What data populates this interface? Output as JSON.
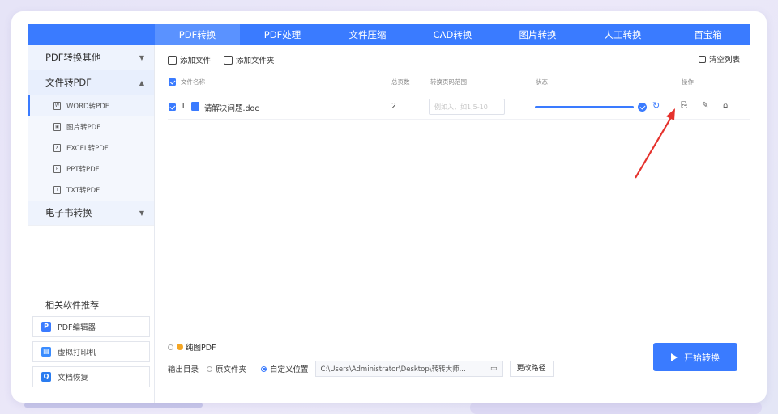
{
  "nav": {
    "tabs": [
      "PDF转换",
      "PDF处理",
      "文件压缩",
      "CAD转换",
      "图片转换",
      "人工转换",
      "百宝箱"
    ],
    "active_index": 0
  },
  "sidebar": {
    "groups": [
      {
        "label": "PDF转换其他",
        "expanded": false
      },
      {
        "label": "文件转PDF",
        "expanded": true
      },
      {
        "label": "电子书转换",
        "expanded": false
      }
    ],
    "sub_items": [
      "WORD转PDF",
      "图片转PDF",
      "EXCEL转PDF",
      "PPT转PDF",
      "TXT转PDF"
    ],
    "active_sub": 0
  },
  "recommend": {
    "title": "相关软件推荐",
    "items": [
      {
        "label": "PDF编辑器",
        "icon": "pdf-editor-icon",
        "color": "#3a7bff"
      },
      {
        "label": "虚拟打印机",
        "icon": "printer-icon",
        "color": "#3a8cff"
      },
      {
        "label": "文档恢复",
        "icon": "recovery-icon",
        "color": "#2a7cf0"
      }
    ]
  },
  "toolbar": {
    "add_file": "添加文件",
    "add_folder": "添加文件夹",
    "clear_list": "清空列表"
  },
  "table": {
    "headers": {
      "name": "文件名称",
      "pages": "总页数",
      "range": "转换页码范围",
      "status": "状态",
      "ops": "操作"
    },
    "rows": [
      {
        "index": "1",
        "filename": "请解决问题.doc",
        "pages": "2",
        "range_placeholder": "例如入，如1,5-10",
        "progress": 1.0
      }
    ]
  },
  "options": {
    "pure_image_pdf": "纯图PDF",
    "output_label": "输出目录",
    "source_folder": "原文件夹",
    "custom_location": "自定义位置",
    "path": "C:\\Users\\Administrator\\Desktop\\转转大师...",
    "change_path": "更改路径"
  },
  "start_button": "开始转换",
  "colors": {
    "accent": "#3a7bff",
    "annotation_arrow": "#e5322d"
  }
}
